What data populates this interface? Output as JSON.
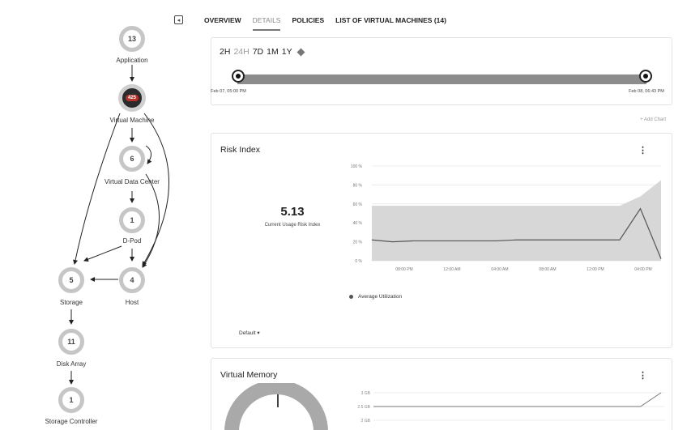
{
  "supply_chain": {
    "nodes": [
      {
        "id": "application",
        "count": "13",
        "label": "Application"
      },
      {
        "id": "virtual-machine",
        "count": "425",
        "label": "Virtual Machine"
      },
      {
        "id": "virtual-data-center",
        "count": "6",
        "label": "Virtual Data Center"
      },
      {
        "id": "d-pod",
        "count": "1",
        "label": "D-Pod"
      },
      {
        "id": "storage",
        "count": "5",
        "label": "Storage"
      },
      {
        "id": "host",
        "count": "4",
        "label": "Host"
      },
      {
        "id": "disk-array",
        "count": "11",
        "label": "Disk Array"
      },
      {
        "id": "storage-controller",
        "count": "1",
        "label": "Storage Controller"
      }
    ]
  },
  "tabs": [
    {
      "label": "OVERVIEW",
      "active": false
    },
    {
      "label": "DETAILS",
      "active": true
    },
    {
      "label": "POLICIES",
      "active": false
    },
    {
      "label": "LIST OF VIRTUAL MACHINES (14)",
      "active": false
    }
  ],
  "time_range": {
    "options": [
      "2H",
      "24H",
      "7D",
      "1M",
      "1Y"
    ],
    "selected": "24H",
    "start_label": "Feb 07, 05:00 PM",
    "end_label": "Feb 08, 06:43 PM"
  },
  "add_chart_label": "+ Add Chart",
  "risk_index": {
    "title": "Risk Index",
    "value": "5.13",
    "caption": "Current Usage Risk Index",
    "legend": "Average Utilization",
    "dropdown": "Default ▾",
    "menu_icon": "kebab-icon"
  },
  "virtual_memory": {
    "title": "Virtual Memory",
    "menu_icon": "kebab-icon"
  },
  "chart_data": [
    {
      "type": "area",
      "title": "",
      "xlabel": "",
      "ylabel": "",
      "y_ticks": [
        "100 %",
        "80 %",
        "60 %",
        "40 %",
        "20 %",
        "0 %"
      ],
      "ylim": [
        0,
        100
      ],
      "x_ticks": [
        "08:00 PM",
        "12:00 AM",
        "04:00 AM",
        "08:00 AM",
        "12:00 PM",
        "04:00 PM"
      ],
      "x": [
        0,
        1,
        2,
        3,
        4,
        5,
        6,
        7,
        8,
        9,
        10,
        11,
        12,
        13,
        14
      ],
      "series": [
        {
          "name": "Average Utilization",
          "values": [
            22,
            20,
            21,
            21,
            21,
            21,
            21,
            22,
            22,
            22,
            22,
            22,
            22,
            55,
            2
          ]
        },
        {
          "values": [
            58,
            58,
            58,
            58,
            58,
            58,
            58,
            58,
            58,
            58,
            58,
            58,
            58,
            68,
            85
          ]
        }
      ],
      "legend": "bottom-left",
      "grid": true
    },
    {
      "type": "line",
      "title": "",
      "y_ticks": [
        "3 GB",
        "2.5 GB",
        "2 GB"
      ],
      "series": [
        {
          "values": [
            2.5,
            2.5,
            2.5,
            2.5,
            2.5,
            2.5,
            2.5,
            2.5,
            2.5,
            2.5,
            2.5,
            2.5,
            2.5,
            2.5,
            3.0
          ]
        }
      ]
    }
  ]
}
